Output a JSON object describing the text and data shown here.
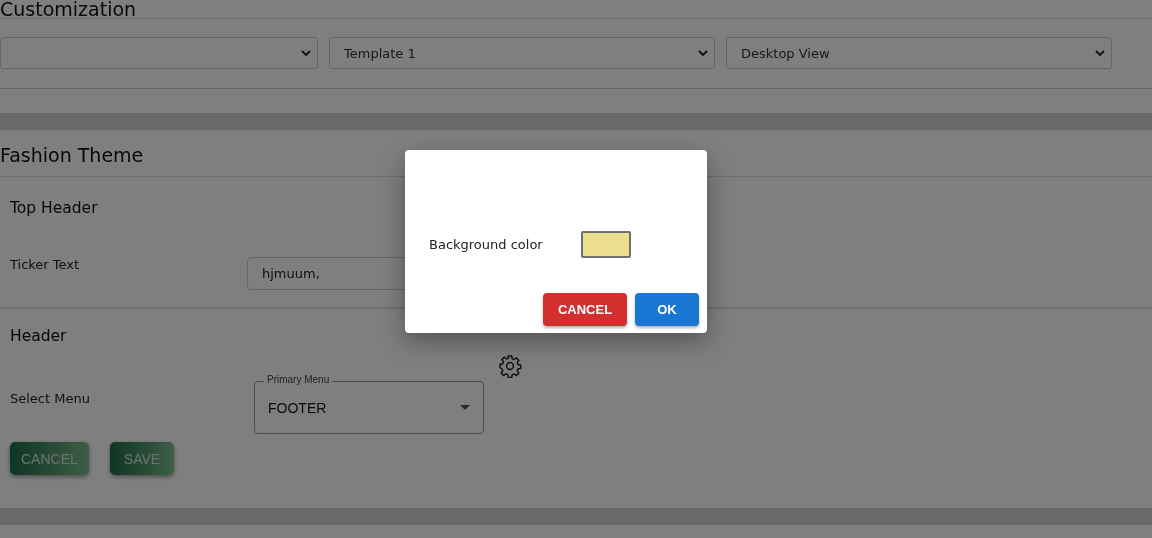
{
  "page_title": "Customization",
  "selects": [
    {
      "kind": "dropdown"
    },
    {
      "kind": "dropdown",
      "value": "Template 1"
    },
    {
      "kind": "dropdown",
      "value": "Desktop View"
    }
  ],
  "theme": {
    "title": "Fashion Theme",
    "top_header": {
      "title": "Top Header",
      "ticker_label": "Ticker Text",
      "ticker_value": "hjmuum,"
    },
    "header": {
      "title": "Header",
      "menu_label": "Select Menu",
      "menu_field_label": "Primary Menu",
      "menu_value": "FOOTER"
    },
    "buttons": [
      {
        "label": "CANCEL",
        "kind": "cancel"
      },
      {
        "label": "SAVE",
        "kind": "save"
      }
    ]
  },
  "dialog": {
    "field_label": "Background color",
    "swatch": {
      "color": "#ebdf8e"
    },
    "buttons": [
      {
        "label": "CANCEL",
        "kind": "cancel"
      },
      {
        "label": "OK",
        "kind": "ok"
      }
    ]
  }
}
